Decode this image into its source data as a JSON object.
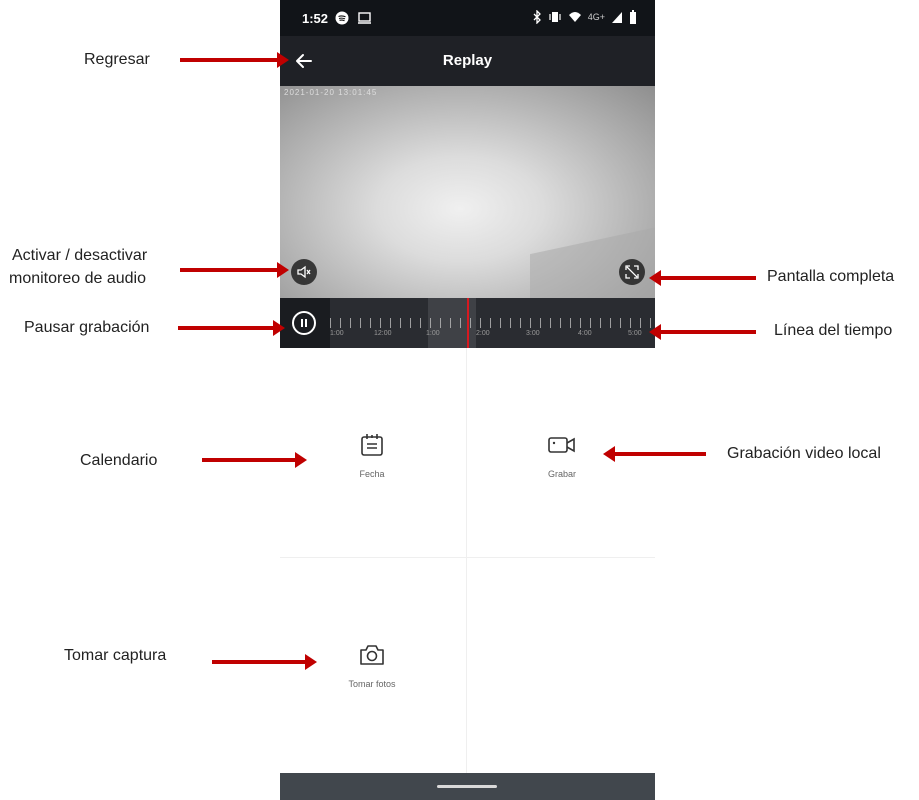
{
  "status_bar": {
    "time": "1:52",
    "network": "4G+"
  },
  "app_bar": {
    "title": "Replay"
  },
  "video": {
    "timestamp": "2021-01-20 13:01:45"
  },
  "timeline": {
    "labels": [
      "1:00",
      "12:00",
      "1:00",
      "2:00",
      "3:00",
      "4:00",
      "5:00"
    ],
    "cursor_color": "#d71920"
  },
  "actions": {
    "date_label": "Fecha",
    "record_label": "Grabar",
    "photo_label": "Tomar fotos"
  },
  "annotations": {
    "back": "Regresar",
    "audio_line1": "Activar / desactivar",
    "audio_line2": "monitoreo de audio",
    "pause": "Pausar grabación",
    "fullscreen": "Pantalla completa",
    "timeline": "Línea del tiempo",
    "calendar": "Calendario",
    "local_record": "Grabación video local",
    "snapshot": "Tomar captura"
  },
  "icons": [
    "back-arrow-icon",
    "spotify-icon",
    "screen-cast-icon",
    "bluetooth-icon",
    "vibrate-icon",
    "wifi-icon",
    "signal-icon",
    "battery-icon",
    "mute-icon",
    "fullscreen-icon",
    "pause-icon",
    "calendar-icon",
    "video-camera-icon",
    "camera-icon"
  ],
  "colors": {
    "arrow": "#c00000",
    "app_bar": "#1f2126",
    "timeline_cursor": "#d71920"
  }
}
